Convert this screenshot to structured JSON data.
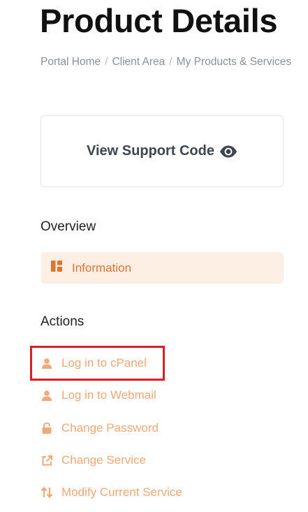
{
  "page": {
    "title": "Product Details"
  },
  "breadcrumb": {
    "items": [
      "Portal Home",
      "Client Area",
      "My Products & Services"
    ]
  },
  "support": {
    "label": "View Support Code",
    "icon": "eye-icon"
  },
  "overview": {
    "title": "Overview",
    "items": [
      {
        "label": "Information",
        "icon": "dashboard-icon",
        "active": true
      }
    ]
  },
  "actions": {
    "title": "Actions",
    "items": [
      {
        "label": "Log in to cPanel",
        "icon": "user-icon",
        "highlighted": true
      },
      {
        "label": "Log in to Webmail",
        "icon": "user-icon"
      },
      {
        "label": "Change Password",
        "icon": "unlock-icon"
      },
      {
        "label": "Change Service",
        "icon": "external-link-icon"
      },
      {
        "label": "Modify Current Service",
        "icon": "sort-arrows-icon"
      }
    ]
  },
  "colors": {
    "accent": "#e1732f",
    "accent_light": "#f2a877",
    "active_bg": "#fdefe4",
    "highlight": "#d9202a"
  }
}
